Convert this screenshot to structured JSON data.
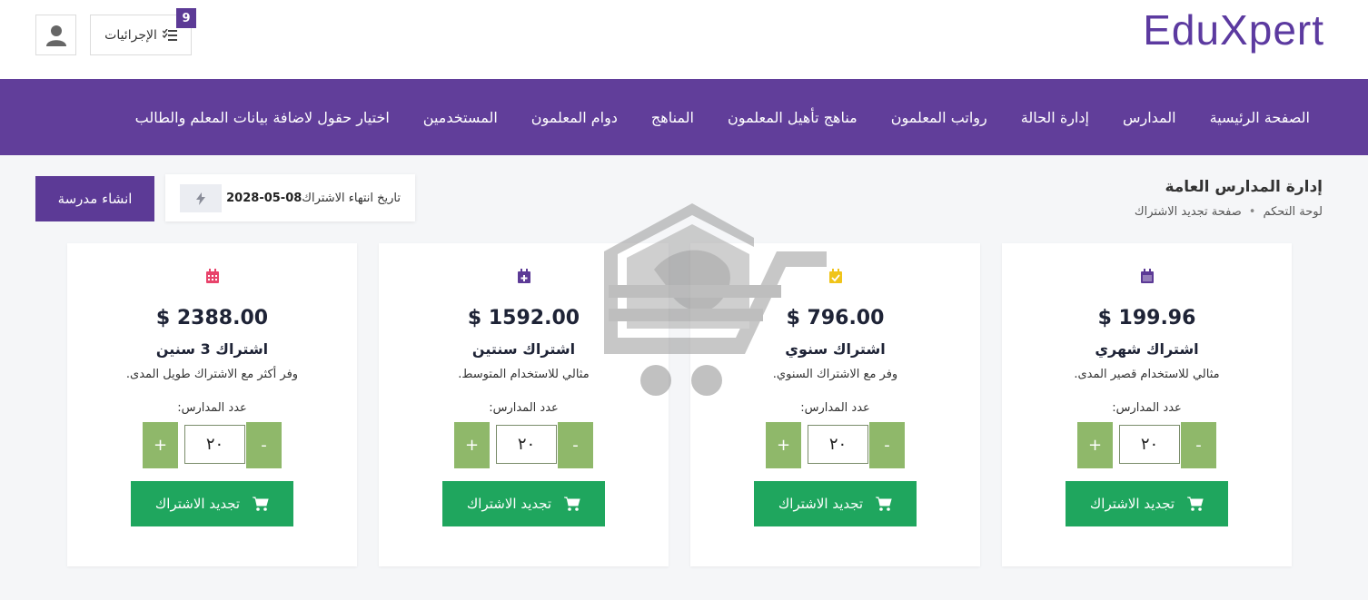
{
  "header": {
    "logo_text": "EduXpert",
    "actions_label": "الإجرائيات",
    "actions_badge": "9"
  },
  "nav": {
    "items": [
      "الصفحة الرئيسية",
      "المدارس",
      "إدارة الحالة",
      "رواتب المعلمون",
      "مناهج تأهيل المعلمون",
      "المناهج",
      "دوام المعلمون",
      "المستخدمين",
      "اختيار حقول لاضافة بيانات المعلم والطالب"
    ]
  },
  "page": {
    "title": "إدارة المدارس العامة",
    "breadcrumb": [
      "لوحة التحكم",
      "صفحة تجديد الاشتراك"
    ]
  },
  "toolbar": {
    "expiry_label": "تاريخ انتهاء الاشتراك",
    "expiry_date": "2028-05-08",
    "create_school_label": "انشاء مدرسة"
  },
  "plans": [
    {
      "price": "199.96 $",
      "name": "اشتراك شهري",
      "description": "مثالي للاستخدام قصير المدى.",
      "count_label": "عدد المدارس:",
      "count_value": "٢٠",
      "renew_label": "تجديد الاشتراك",
      "icon": "calendar-icon",
      "icon_color": "#5c3a96"
    },
    {
      "price": "796.00 $",
      "name": "اشتراك سنوي",
      "description": "وفر مع الاشتراك السنوي.",
      "count_label": "عدد المدارس:",
      "count_value": "٢٠",
      "renew_label": "تجديد الاشتراك",
      "icon": "calendar-check-icon",
      "icon_color": "#f0c419"
    },
    {
      "price": "1592.00 $",
      "name": "اشتراك سنتين",
      "description": "مثالي للاستخدام المتوسط.",
      "count_label": "عدد المدارس:",
      "count_value": "٢٠",
      "renew_label": "تجديد الاشتراك",
      "icon": "calendar-plus-icon",
      "icon_color": "#5c3a96"
    },
    {
      "price": "2388.00 $",
      "name": "اشتراك 3 سنين",
      "description": "وفر أكثر مع الاشتراك طويل المدى.",
      "count_label": "عدد المدارس:",
      "count_value": "٢٠",
      "renew_label": "تجديد الاشتراك",
      "icon": "calendar-grid-icon",
      "icon_color": "#e8436b"
    }
  ],
  "stepper": {
    "plus": "+",
    "minus": "-"
  },
  "colors": {
    "brand": "#613e9a",
    "renew": "#1fa65e",
    "stepper": "#8fb86a"
  }
}
